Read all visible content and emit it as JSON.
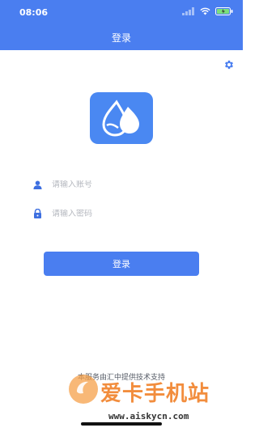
{
  "status_bar": {
    "time": "08:06"
  },
  "header": {
    "title": "登录",
    "background_color": "#4a7ef0"
  },
  "settings": {
    "icon": "gear-icon"
  },
  "logo": {
    "icon": "water-drops-icon",
    "background_color": "#4a88f2"
  },
  "form": {
    "account_placeholder": "请输入账号",
    "account_icon": "user-icon",
    "password_placeholder": "请输入密码",
    "password_icon": "lock-icon",
    "login_label": "登录"
  },
  "footer": {
    "text": "本服务由汇中提供技术支持"
  },
  "watermark": {
    "title": "爱卡手机站",
    "url": "www.aiskycn.com"
  }
}
